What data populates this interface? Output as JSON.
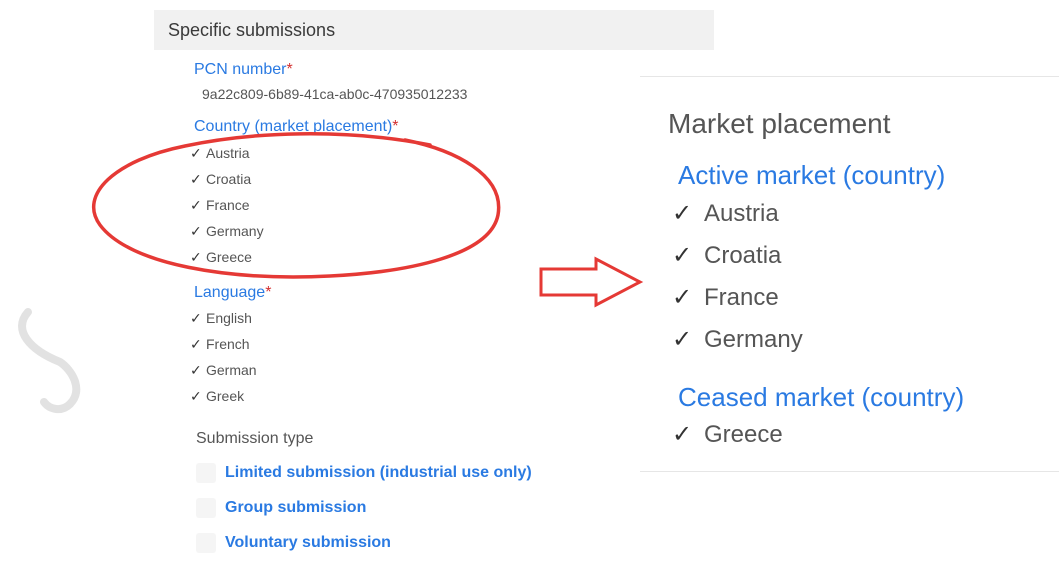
{
  "left": {
    "header": "Specific submissions",
    "pcn_label": "PCN number",
    "pcn_value": "9a22c809-6b89-41ca-ab0c-470935012233",
    "country_label": "Country (market placement)",
    "countries": [
      "Austria",
      "Croatia",
      "France",
      "Germany",
      "Greece"
    ],
    "language_label": "Language",
    "languages": [
      "English",
      "French",
      "German",
      "Greek"
    ],
    "required_mark": "*",
    "submission_type_label": "Submission type",
    "submission_types": [
      "Limited submission (industrial use only)",
      "Group submission",
      "Voluntary submission"
    ]
  },
  "right": {
    "title": "Market placement",
    "active_label": "Active market (country)",
    "active_countries": [
      "Austria",
      "Croatia",
      "France",
      "Germany"
    ],
    "ceased_label": "Ceased market (country)",
    "ceased_countries": [
      "Greece"
    ]
  },
  "icons": {
    "check": "check-icon",
    "arrow": "arrow-right-icon"
  },
  "colors": {
    "label_blue": "#2a7ae2",
    "required_red": "#d32f2f",
    "annotation_red": "#e53935",
    "header_bg": "#f1f1f1"
  }
}
